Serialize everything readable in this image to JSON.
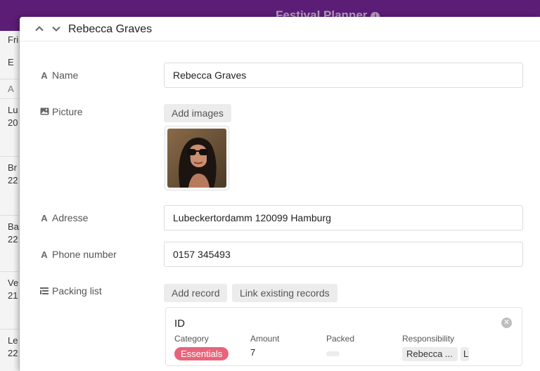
{
  "app": {
    "title": "Festival Planner",
    "info_icon": "info-icon",
    "header_color": "#5b1d75",
    "bg_rows": [
      "Fri",
      "E",
      "A",
      "Lu",
      "20",
      "Br",
      "22",
      "Ba",
      "22",
      "Ve",
      "21",
      "Le",
      "22"
    ]
  },
  "record": {
    "title": "Rebecca Graves",
    "fields": {
      "name": {
        "label": "Name",
        "value": "Rebecca Graves",
        "icon": "text-icon"
      },
      "picture": {
        "label": "Picture",
        "add_button": "Add images",
        "icon": "image-icon"
      },
      "address": {
        "label": "Adresse",
        "value": "Lubeckertordamm 120099 Hamburg",
        "icon": "text-icon"
      },
      "phone": {
        "label": "Phone number",
        "value": "0157 345493",
        "icon": "text-icon"
      },
      "packing": {
        "label": "Packing list",
        "icon": "list-icon",
        "add_button": "Add record",
        "link_button": "Link existing records",
        "card": {
          "id": "ID",
          "columns": {
            "category": "Category",
            "amount": "Amount",
            "packed": "Packed",
            "responsibility": "Responsibility"
          },
          "category_value": "Essentials",
          "category_color": "#e9647b",
          "amount_value": "7",
          "responsibility_values": [
            "Rebecca ...",
            "L"
          ]
        }
      }
    }
  }
}
